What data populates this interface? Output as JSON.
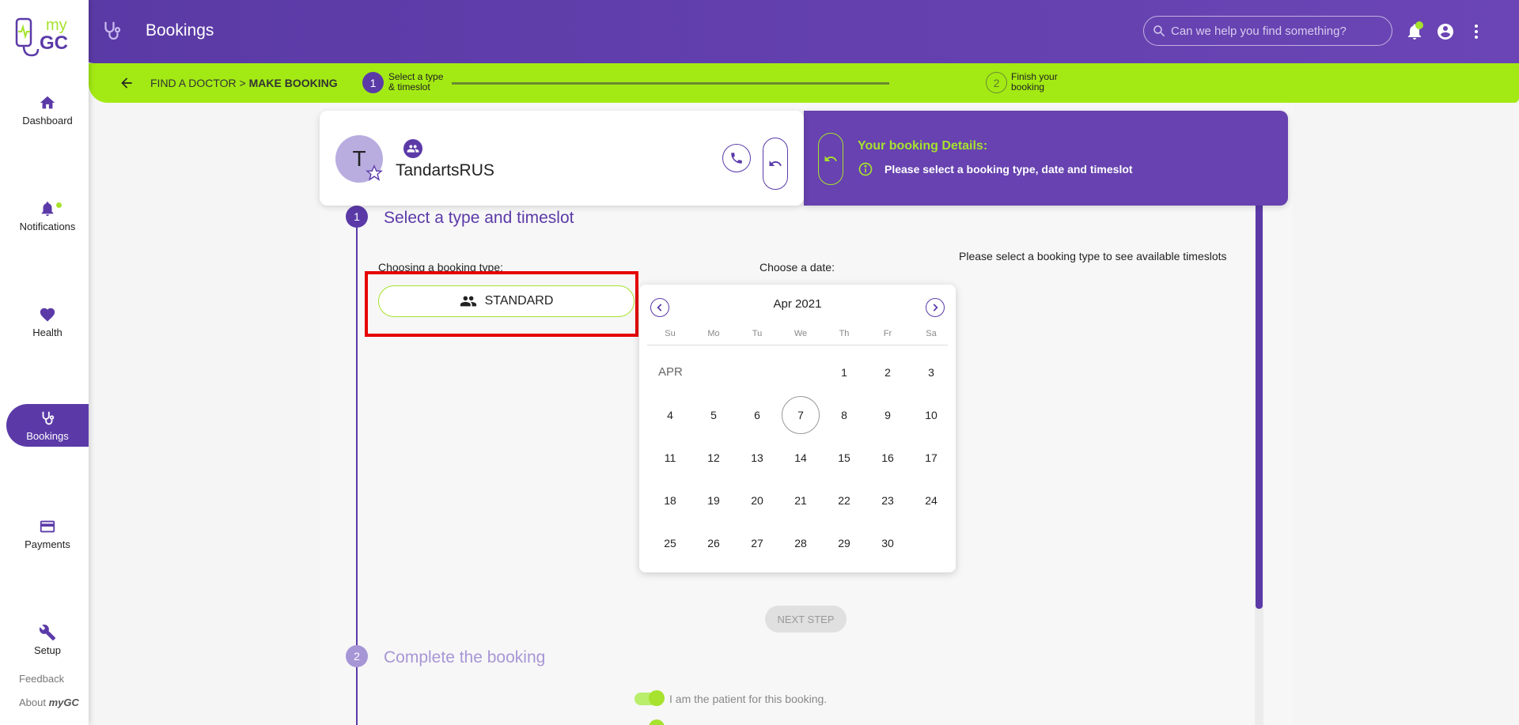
{
  "app": {
    "logo_text": "myGC",
    "title": "Bookings"
  },
  "search": {
    "placeholder": "Can we help you find something?"
  },
  "sidebar": {
    "items": [
      {
        "label": "Dashboard",
        "icon": "home-icon"
      },
      {
        "label": "Notifications",
        "icon": "bell-icon"
      },
      {
        "label": "Health",
        "icon": "heart-icon"
      },
      {
        "label": "Bookings",
        "icon": "stethoscope-icon"
      },
      {
        "label": "Payments",
        "icon": "credit-card-icon"
      },
      {
        "label": "Setup",
        "icon": "wrench-icon"
      }
    ],
    "feedback": "Feedback",
    "about_prefix": "About ",
    "about_brand": "myGC"
  },
  "breadcrumb": {
    "part1": "FIND A DOCTOR",
    "separator": ">",
    "part2": "MAKE BOOKING"
  },
  "stepper": {
    "step1_num": "1",
    "step1_line1": "Select a type",
    "step1_line2": "& timeslot",
    "step2_num": "2",
    "step2_line1": "Finish your",
    "step2_line2": "booking"
  },
  "provider": {
    "initial": "T",
    "name": "TandartsRUS"
  },
  "details": {
    "title": "Your booking Details:",
    "info": "Please select a booking type, date and timeslot"
  },
  "section1": {
    "num": "1",
    "title": "Select a type and timeslot"
  },
  "booking_type": {
    "label": "Choosing a booking type:",
    "standard_label": "STANDARD"
  },
  "date": {
    "label": "Choose a date:"
  },
  "timeslot_tip": "Please select a booking type to see available timeslots",
  "calendar": {
    "month_label": "Apr 2021",
    "month_short": "APR",
    "weekdays": [
      "Su",
      "Mo",
      "Tu",
      "We",
      "Th",
      "Fr",
      "Sa"
    ],
    "first_weekday": 4,
    "days_in_month": 30,
    "selected_day": 7
  },
  "next_step": "NEXT STEP",
  "section2": {
    "num": "2",
    "title": "Complete the booking"
  },
  "patient_toggle": {
    "label": "I am the patient for this booking.",
    "checked": true
  },
  "colors": {
    "primary": "#5b3aa8",
    "accent": "#a6e22e",
    "highlight": "#e60000"
  }
}
